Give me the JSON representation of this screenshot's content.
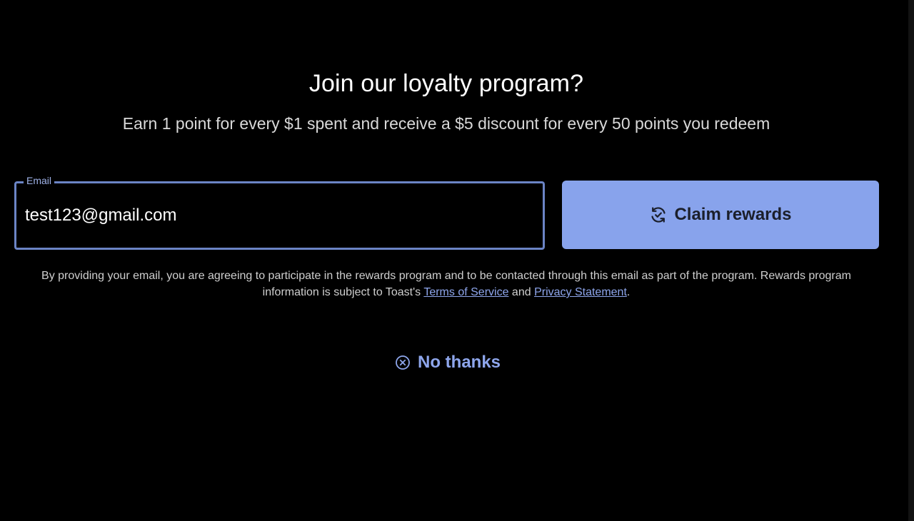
{
  "page": {
    "title": "Join our loyalty program?",
    "subtitle": "Earn 1 point for every $1 spent and receive a $5 discount for every 50 points you redeem"
  },
  "email": {
    "label": "Email",
    "value": "test123@gmail.com"
  },
  "claim_button": {
    "label": "Claim rewards",
    "icon": "rewards-cycle-icon"
  },
  "disclaimer": {
    "text_before": "By providing your email, you are agreeing to participate in the rewards program and to be contacted through this email as part of the program. Rewards program information is subject to Toast's ",
    "terms_link": "Terms of Service",
    "and_text": " and ",
    "privacy_link": "Privacy Statement",
    "period": "."
  },
  "no_thanks": {
    "label": "No thanks",
    "icon": "close-circle-icon"
  },
  "colors": {
    "accent": "#88a3ec",
    "link": "#8ea6ec",
    "field_border": "#6b84c5",
    "background": "#000000"
  }
}
